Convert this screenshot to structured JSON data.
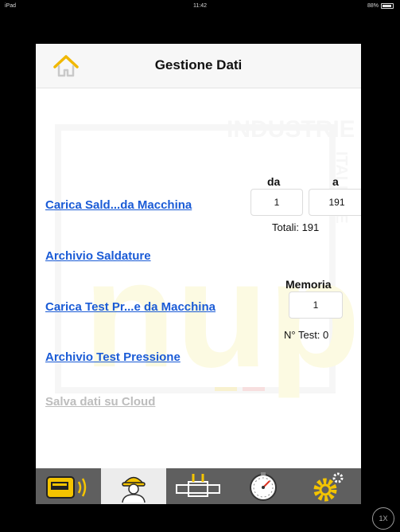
{
  "status_bar": {
    "device": "iPad",
    "time": "11:42",
    "battery": "88%"
  },
  "header": {
    "title": "Gestione Dati",
    "home_icon": "home-icon"
  },
  "watermark": {
    "brand_top": "INDUSTRIE",
    "brand_main": "nupi",
    "brand_side": "ITALIANE"
  },
  "main": {
    "load_welds_link": "Carica Sald...da Macchina",
    "range": {
      "from_label": "da",
      "to_label": "a",
      "from_value": "1",
      "to_value": "191",
      "totals": "Totali: 191"
    },
    "weld_archive_link": "Archivio Saldature",
    "memory_label": "Memoria",
    "memory_value": "1",
    "load_tests_link": "Carica Test Pr...e da Macchina",
    "test_count": "N° Test: 0",
    "pressure_archive_link": "Archivio Test Pressione",
    "cloud_save_link": "Salva dati su Cloud"
  },
  "tabbar": {
    "tabs": [
      {
        "icon": "welding-machine-wireless-icon",
        "selected": false
      },
      {
        "icon": "operator-helmet-icon",
        "selected": true
      },
      {
        "icon": "pipe-fitting-icon",
        "selected": false
      },
      {
        "icon": "pressure-gauge-icon",
        "selected": false
      },
      {
        "icon": "settings-gear-icon",
        "selected": false
      }
    ]
  },
  "zoom_badge": "1X",
  "colors": {
    "link": "#1a5bd6",
    "disabled_link": "#bdbdbd",
    "tabbar": "#5f5f5f",
    "accent_yellow": "#f4c400"
  }
}
